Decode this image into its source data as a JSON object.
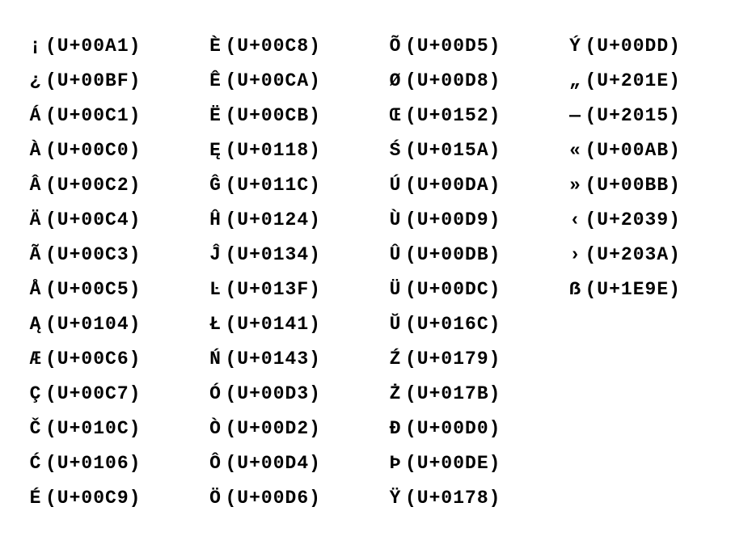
{
  "columns": [
    {
      "entries": [
        {
          "glyph": "¡",
          "code": "U+00A1"
        },
        {
          "glyph": "¿",
          "code": "U+00BF"
        },
        {
          "glyph": "Á",
          "code": "U+00C1"
        },
        {
          "glyph": "À",
          "code": "U+00C0"
        },
        {
          "glyph": "Â",
          "code": "U+00C2"
        },
        {
          "glyph": "Ä",
          "code": "U+00C4"
        },
        {
          "glyph": "Ã",
          "code": "U+00C3"
        },
        {
          "glyph": "Å",
          "code": "U+00C5"
        },
        {
          "glyph": "Ą",
          "code": "U+0104"
        },
        {
          "glyph": "Æ",
          "code": "U+00C6"
        },
        {
          "glyph": "Ç",
          "code": "U+00C7"
        },
        {
          "glyph": "Č",
          "code": "U+010C"
        },
        {
          "glyph": "Ć",
          "code": "U+0106"
        },
        {
          "glyph": "É",
          "code": "U+00C9"
        }
      ]
    },
    {
      "entries": [
        {
          "glyph": "È",
          "code": "U+00C8"
        },
        {
          "glyph": "Ê",
          "code": "U+00CA"
        },
        {
          "glyph": "Ë",
          "code": "U+00CB"
        },
        {
          "glyph": "Ę",
          "code": "U+0118"
        },
        {
          "glyph": "Ĝ",
          "code": "U+011C"
        },
        {
          "glyph": "Ĥ",
          "code": "U+0124"
        },
        {
          "glyph": "Ĵ",
          "code": "U+0134"
        },
        {
          "glyph": "Ŀ",
          "code": "U+013F"
        },
        {
          "glyph": "Ł",
          "code": "U+0141"
        },
        {
          "glyph": "Ń",
          "code": "U+0143"
        },
        {
          "glyph": "Ó",
          "code": "U+00D3"
        },
        {
          "glyph": "Ò",
          "code": "U+00D2"
        },
        {
          "glyph": "Ô",
          "code": "U+00D4"
        },
        {
          "glyph": "Ö",
          "code": "U+00D6"
        }
      ]
    },
    {
      "entries": [
        {
          "glyph": "Õ",
          "code": "U+00D5"
        },
        {
          "glyph": "Ø",
          "code": "U+00D8"
        },
        {
          "glyph": "Œ",
          "code": "U+0152"
        },
        {
          "glyph": "Ś",
          "code": "U+015A"
        },
        {
          "glyph": "Ú",
          "code": "U+00DA"
        },
        {
          "glyph": "Ù",
          "code": "U+00D9"
        },
        {
          "glyph": "Û",
          "code": "U+00DB"
        },
        {
          "glyph": "Ü",
          "code": "U+00DC"
        },
        {
          "glyph": "Ŭ",
          "code": "U+016C"
        },
        {
          "glyph": "Ź",
          "code": "U+0179"
        },
        {
          "glyph": "Ż",
          "code": "U+017B"
        },
        {
          "glyph": "Ð",
          "code": "U+00D0"
        },
        {
          "glyph": "Þ",
          "code": "U+00DE"
        },
        {
          "glyph": "Ÿ",
          "code": "U+0178"
        }
      ]
    },
    {
      "entries": [
        {
          "glyph": "Ý",
          "code": "U+00DD"
        },
        {
          "glyph": "„",
          "code": "U+201E"
        },
        {
          "glyph": "―",
          "code": "U+2015"
        },
        {
          "glyph": "«",
          "code": "U+00AB"
        },
        {
          "glyph": "»",
          "code": "U+00BB"
        },
        {
          "glyph": "‹",
          "code": "U+2039"
        },
        {
          "glyph": "›",
          "code": "U+203A"
        },
        {
          "glyph": "ẞ",
          "code": "U+1E9E"
        }
      ]
    }
  ]
}
